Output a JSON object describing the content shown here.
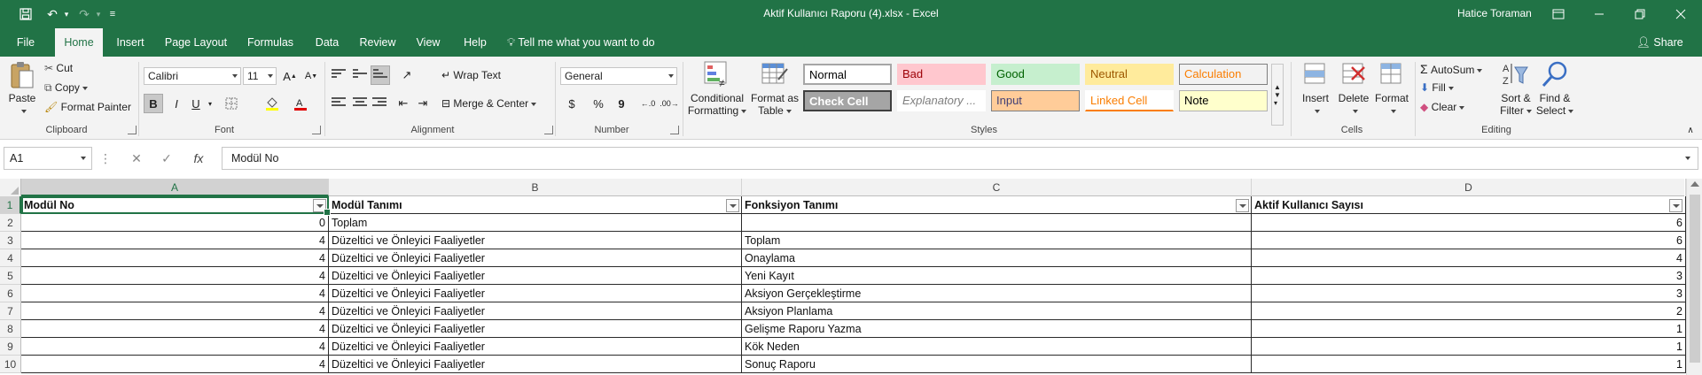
{
  "titlebar": {
    "document_title": "Aktif Kullanıcı Raporu (4).xlsx  -  Excel",
    "user_name": "Hatice Toraman"
  },
  "tabs": [
    "File",
    "Home",
    "Insert",
    "Page Layout",
    "Formulas",
    "Data",
    "Review",
    "View",
    "Help"
  ],
  "tell_me": "Tell me what you want to do",
  "share": "Share",
  "ribbon": {
    "clipboard": {
      "paste": "Paste",
      "cut": "Cut",
      "copy": "Copy",
      "format_painter": "Format Painter",
      "label": "Clipboard"
    },
    "font": {
      "name": "Calibri",
      "size": "11",
      "bold": "B",
      "italic": "I",
      "underline": "U",
      "label": "Font"
    },
    "alignment": {
      "wrap_text": "Wrap Text",
      "merge_center": "Merge & Center",
      "label": "Alignment"
    },
    "number": {
      "format": "General",
      "currency": "$",
      "percent": "%",
      "comma": "9",
      "label": "Number"
    },
    "styles": {
      "conditional_formatting": "Conditional Formatting",
      "format_as_table": "Format as Table",
      "cells": [
        {
          "name": "Normal",
          "bg": "#ffffff",
          "fg": "#000000",
          "border": "#a6a6a6"
        },
        {
          "name": "Bad",
          "bg": "#ffc7ce",
          "fg": "#9c0006",
          "border": "#ffc7ce"
        },
        {
          "name": "Good",
          "bg": "#c6efce",
          "fg": "#006100",
          "border": "#c6efce"
        },
        {
          "name": "Neutral",
          "bg": "#ffeb9c",
          "fg": "#9c5700",
          "border": "#ffeb9c"
        },
        {
          "name": "Calculation",
          "bg": "#f2f2f2",
          "fg": "#fa7d00",
          "border": "#7f7f7f"
        },
        {
          "name": "Check Cell",
          "bg": "#a5a5a5",
          "fg": "#ffffff",
          "border": "#3f3f3f"
        },
        {
          "name": "Explanatory ...",
          "bg": "#ffffff",
          "fg": "#7f7f7f",
          "border": "#ffffff"
        },
        {
          "name": "Input",
          "bg": "#ffcc99",
          "fg": "#3f3f76",
          "border": "#7f7f7f"
        },
        {
          "name": "Linked Cell",
          "bg": "#ffffff",
          "fg": "#fa7d00",
          "border": "#ffffff"
        },
        {
          "name": "Note",
          "bg": "#ffffcc",
          "fg": "#000000",
          "border": "#b2b2b2"
        }
      ],
      "label": "Styles"
    },
    "cells": {
      "insert": "Insert",
      "delete": "Delete",
      "format": "Format",
      "label": "Cells"
    },
    "editing": {
      "autosum": "AutoSum",
      "fill": "Fill",
      "clear": "Clear",
      "sort_filter": "Sort & Filter",
      "find_select": "Find & Select",
      "label": "Editing"
    }
  },
  "formula_bar": {
    "name_box": "A1",
    "fx": "fx",
    "content": "Modül No"
  },
  "columns": [
    "A",
    "B",
    "C",
    "D"
  ],
  "header_row": [
    "Modül No",
    "Modül Tanımı",
    "Fonksiyon Tanımı",
    "Aktif Kullanıcı Sayısı"
  ],
  "rows": [
    {
      "n": "2",
      "a": "0",
      "b": "Toplam",
      "c": "",
      "d": "6"
    },
    {
      "n": "3",
      "a": "4",
      "b": "Düzeltici ve Önleyici Faaliyetler",
      "c": "Toplam",
      "d": "6"
    },
    {
      "n": "4",
      "a": "4",
      "b": "Düzeltici ve Önleyici Faaliyetler",
      "c": "Onaylama",
      "d": "4"
    },
    {
      "n": "5",
      "a": "4",
      "b": "Düzeltici ve Önleyici Faaliyetler",
      "c": "Yeni Kayıt",
      "d": "3"
    },
    {
      "n": "6",
      "a": "4",
      "b": "Düzeltici ve Önleyici Faaliyetler",
      "c": "Aksiyon Gerçekleştirme",
      "d": "3"
    },
    {
      "n": "7",
      "a": "4",
      "b": "Düzeltici ve Önleyici Faaliyetler",
      "c": "Aksiyon Planlama",
      "d": "2"
    },
    {
      "n": "8",
      "a": "4",
      "b": "Düzeltici ve Önleyici Faaliyetler",
      "c": "Gelişme Raporu Yazma",
      "d": "1"
    },
    {
      "n": "9",
      "a": "4",
      "b": "Düzeltici ve Önleyici Faaliyetler",
      "c": "Kök Neden",
      "d": "1"
    },
    {
      "n": "10",
      "a": "4",
      "b": "Düzeltici ve Önleyici Faaliyetler",
      "c": "Sonuç Raporu",
      "d": "1"
    }
  ],
  "accent_color": "#217346"
}
